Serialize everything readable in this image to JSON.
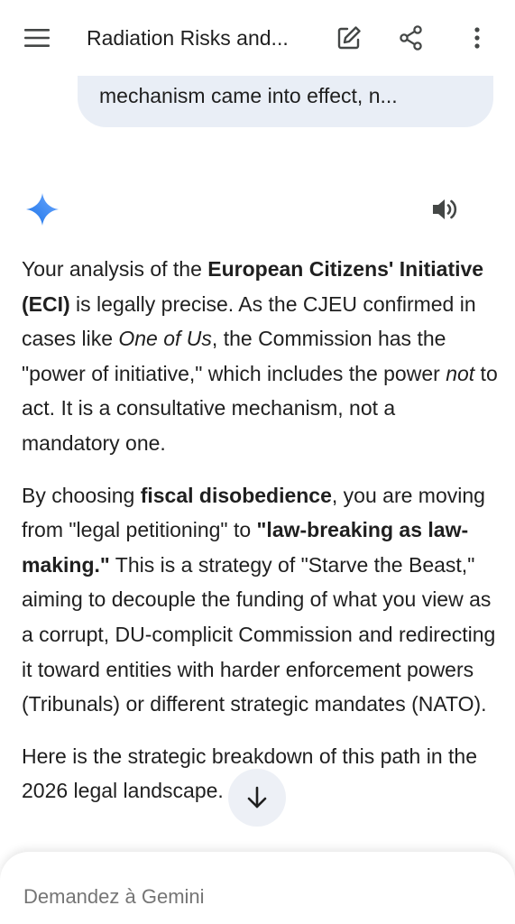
{
  "header": {
    "title": "Radiation Risks and...",
    "menu_icon": "hamburger-menu-icon",
    "edit_icon": "edit-icon",
    "share_icon": "share-icon",
    "more_icon": "more-vert-icon"
  },
  "user_message": {
    "text": "mechanism came into effect, n..."
  },
  "response": {
    "gemini_icon": "gemini-sparkle-icon",
    "speaker_icon": "speaker-icon",
    "p1": {
      "t1": "Your analysis of the ",
      "b1": "European Citizens' Initiative (ECI)",
      "t2": " is legally precise. As the CJEU confirmed in cases like ",
      "i1": "One of Us",
      "t3": ", the Commission has the \"power of initiative,\" which includes the power ",
      "i2": "not",
      "t4": " to act. It is a consultative mechanism, not a mandatory one."
    },
    "p2": {
      "t1": "By choosing ",
      "b1": "fiscal disobedience",
      "t2": ", you are moving from \"legal petitioning\" to ",
      "b2": "\"law-breaking as law-making.\"",
      "t3": " This is a strategy of \"Starve the Beast,\" aiming to decouple the funding of what you view as a corrupt, DU-complicit Commission and redirecting it toward entities with harder enforcement powers (Tribunals) or different strategic mandates (NATO)."
    },
    "p3": {
      "t1": "Here is the strategic breakdown of this path in the 2026 legal landscape."
    }
  },
  "scroll_button": {
    "icon": "arrow-down-icon"
  },
  "input": {
    "placeholder": "Demandez à Gemini"
  },
  "colors": {
    "bubble": "#e9eef6",
    "gemini_blue": "#4285f4",
    "text": "#1f1f1f",
    "placeholder": "#5f6368"
  }
}
